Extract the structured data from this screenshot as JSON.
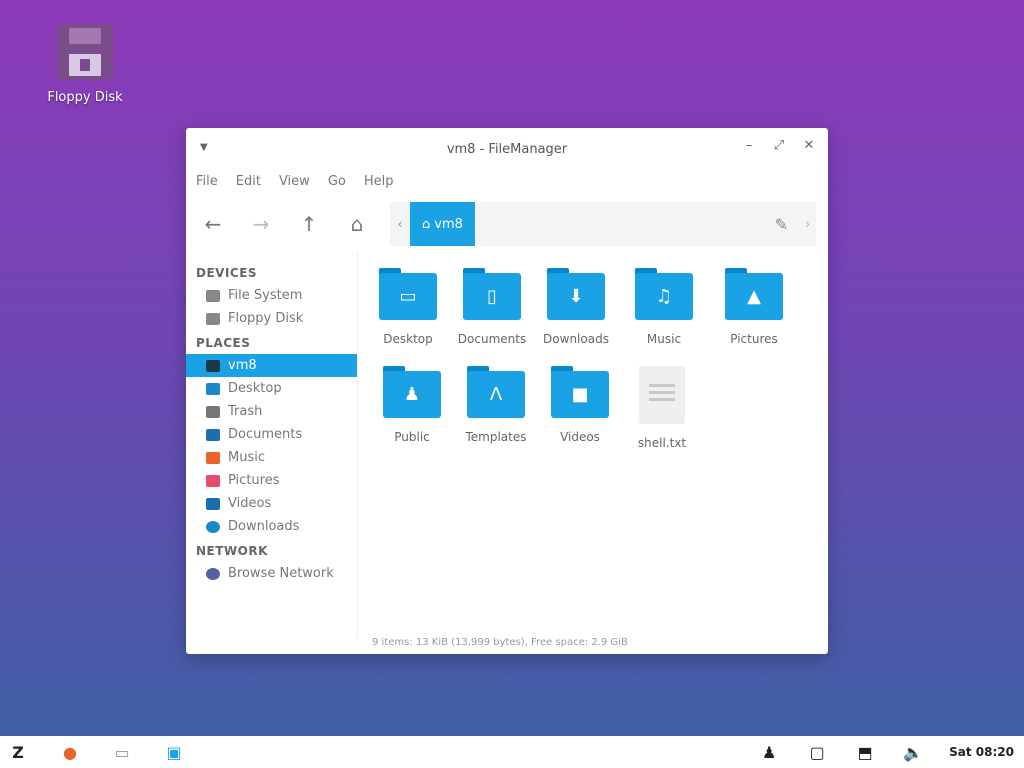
{
  "desktop": {
    "icon_label": "Floppy Disk"
  },
  "window": {
    "title": "vm8 - FileManager",
    "menu": [
      "File",
      "Edit",
      "View",
      "Go",
      "Help"
    ],
    "path_crumb": "vm8",
    "sidebar": {
      "devices_header": "DEVICES",
      "devices": [
        "File System",
        "Floppy Disk"
      ],
      "places_header": "PLACES",
      "places": [
        "vm8",
        "Desktop",
        "Trash",
        "Documents",
        "Music",
        "Pictures",
        "Videos",
        "Downloads"
      ],
      "network_header": "NETWORK",
      "network": [
        "Browse Network"
      ]
    },
    "items": [
      {
        "name": "Desktop",
        "glyph": "▭"
      },
      {
        "name": "Documents",
        "glyph": "▯"
      },
      {
        "name": "Downloads",
        "glyph": "⬇"
      },
      {
        "name": "Music",
        "glyph": "♫"
      },
      {
        "name": "Pictures",
        "glyph": "▲"
      },
      {
        "name": "Public",
        "glyph": "♟"
      },
      {
        "name": "Templates",
        "glyph": "Ʌ"
      },
      {
        "name": "Videos",
        "glyph": "■"
      },
      {
        "name": "shell.txt",
        "glyph": ""
      }
    ],
    "status": "9 items: 13 KiB (13,999 bytes), Free space: 2.9 GiB"
  },
  "taskbar": {
    "clock": "Sat 08:20"
  },
  "colors": {
    "accent": "#1aa2e4",
    "desktop_top": "#8d3ab8",
    "desktop_bottom": "#3f62a6"
  }
}
